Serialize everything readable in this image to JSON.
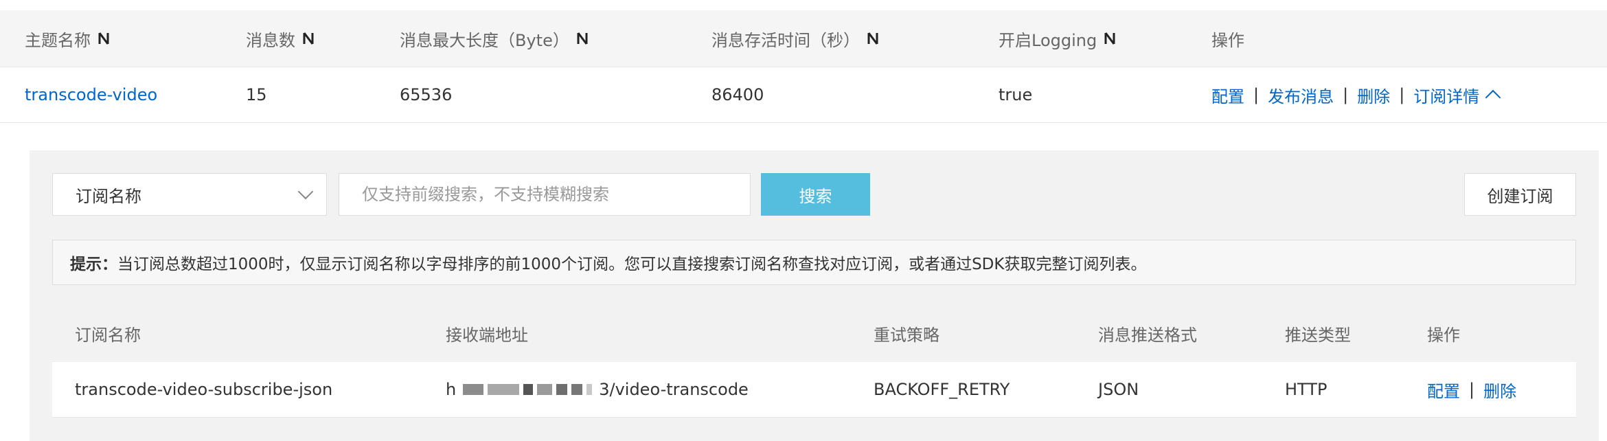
{
  "topic_table": {
    "headers": {
      "name": "主题名称",
      "count": "消息数",
      "max_len": "消息最大长度（Byte）",
      "ttl": "消息存活时间（秒）",
      "logging": "开启Logging",
      "ops": "操作"
    },
    "row": {
      "name": "transcode-video",
      "count": "15",
      "max_len": "65536",
      "ttl": "86400",
      "logging": "true",
      "actions": {
        "configure": "配置",
        "publish": "发布消息",
        "delete": "删除",
        "details": "订阅详情"
      }
    }
  },
  "subscription_panel": {
    "filter_select": "订阅名称",
    "search_placeholder": "仅支持前缀搜索，不支持模糊搜索",
    "search_button": "搜索",
    "create_button": "创建订阅",
    "tip_label": "提示：",
    "tip_text": "当订阅总数超过1000时，仅显示订阅名称以字母排序的前1000个订阅。您可以直接搜索订阅名称查找对应订阅，或者通过SDK获取完整订阅列表。",
    "headers": {
      "name": "订阅名称",
      "endpoint": "接收端地址",
      "retry": "重试策略",
      "format": "消息推送格式",
      "type": "推送类型",
      "ops": "操作"
    },
    "row": {
      "name": "transcode-video-subscribe-json",
      "endpoint_prefix": "h",
      "endpoint_suffix": "3/video-transcode",
      "retry": "BACKOFF_RETRY",
      "format": "JSON",
      "type": "HTTP",
      "actions": {
        "configure": "配置",
        "delete": "删除"
      }
    }
  },
  "colors": {
    "link": "#0066cc",
    "search_button": "#55bedf",
    "panel_bg": "#f2f2f2",
    "header_bg": "#f5f5f5"
  },
  "icons": {
    "sort": "sort-icon",
    "collapse": "chevron-up-icon",
    "dropdown": "chevron-down-icon"
  }
}
